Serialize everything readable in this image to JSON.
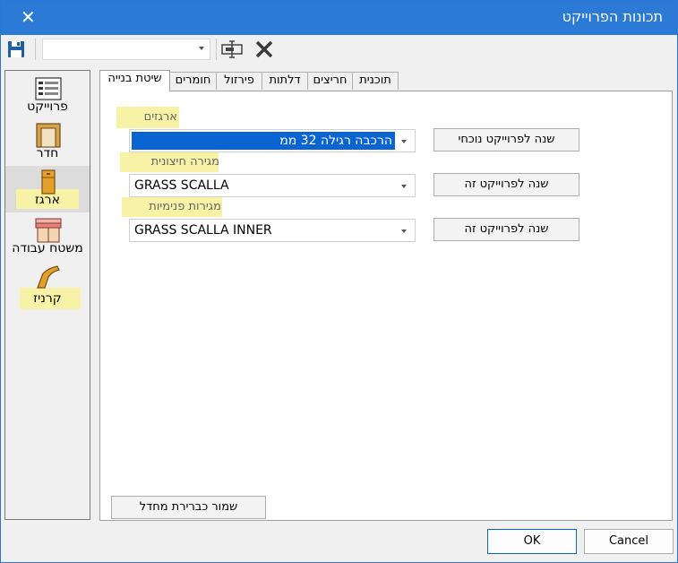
{
  "window": {
    "title": "תכונות הפרוייקט",
    "close_symbol": "✕"
  },
  "toolbar": {
    "save_icon": "save-icon",
    "combo_value": "",
    "form_icon": "form-icon",
    "delete_icon": "delete-icon"
  },
  "sidebar": {
    "items": [
      {
        "label": "פרוייקט",
        "icon": "project-icon"
      },
      {
        "label": "חדר",
        "icon": "room-icon"
      },
      {
        "label": "ארגז",
        "icon": "cabinet-icon"
      },
      {
        "label": "משטח עבודה",
        "icon": "worktop-icon"
      },
      {
        "label": "קרניז",
        "icon": "cornice-icon"
      }
    ],
    "selected_index": 2
  },
  "tabs": [
    {
      "label": "תוכנית"
    },
    {
      "label": "חריצים"
    },
    {
      "label": "דלתות"
    },
    {
      "label": "פירזול"
    },
    {
      "label": "חומרים"
    },
    {
      "label": "שיטת בנייה"
    }
  ],
  "active_tab": 5,
  "main": {
    "fields": [
      {
        "label": "ארגזים",
        "value": "הרכבה רגילה 32 ממ",
        "button": "שנה לפרוייקט נוכחי"
      },
      {
        "label": "מגירה חיצונית",
        "value": "GRASS SCALLA",
        "button": "שנה לפרוייקט זה"
      },
      {
        "label": "מגירות פנימיות",
        "value": "GRASS SCALLA INNER",
        "button": "שנה לפרוייקט זה"
      }
    ],
    "save_default_button": "שמור כברירת מחדל"
  },
  "footer": {
    "ok_label": "OK",
    "cancel_label": "Cancel"
  },
  "colors": {
    "titlebar": "#2a7ad6",
    "highlight": "#f8f2a6",
    "selection": "#0a64d2"
  }
}
